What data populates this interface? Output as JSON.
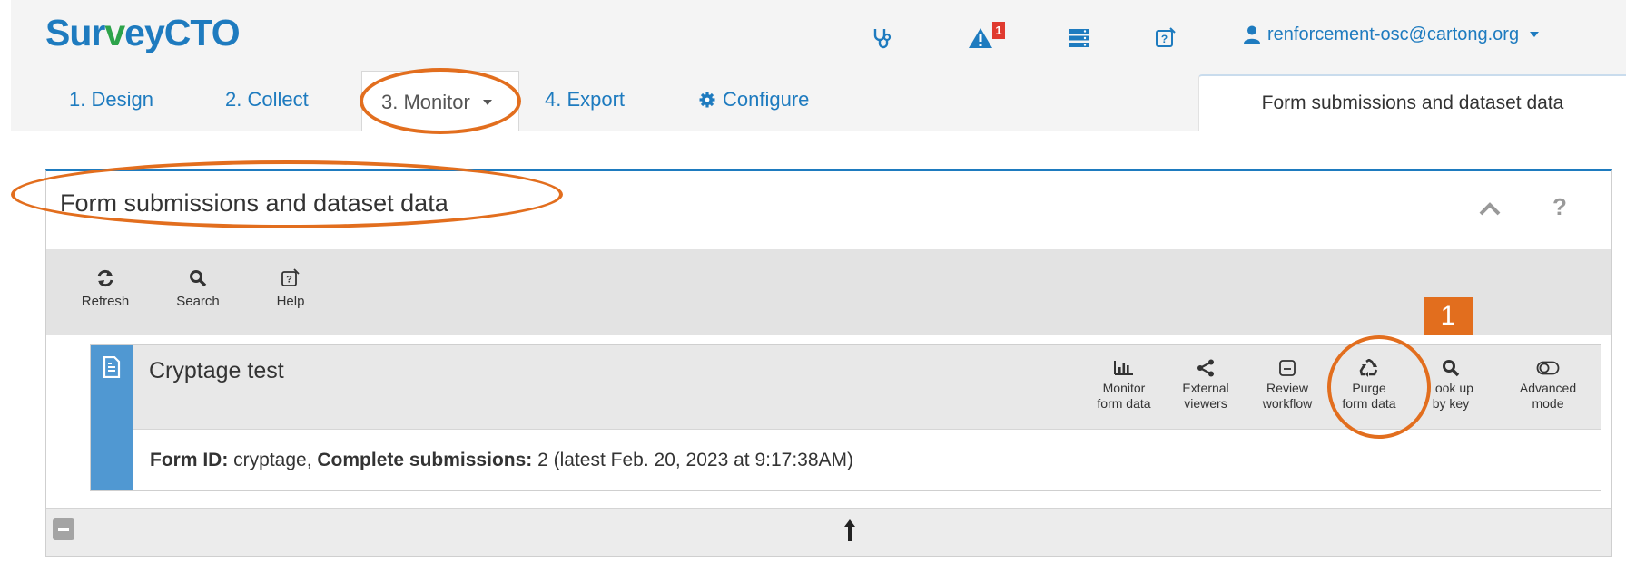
{
  "app": {
    "logo_part1": "Sur",
    "logo_part2": "v",
    "logo_part3": "eyCTO"
  },
  "header": {
    "alert_count": "1",
    "user_email": "renforcement-osc@cartong.org",
    "icons": [
      "stethoscope-icon",
      "warning-icon",
      "server-icon",
      "help-icon",
      "user-icon"
    ]
  },
  "nav": {
    "tabs": [
      {
        "label": "1. Design"
      },
      {
        "label": "2. Collect"
      },
      {
        "label": "3. Monitor"
      },
      {
        "label": "4. Export"
      },
      {
        "label": "Configure"
      }
    ],
    "right_tab_label": "Form submissions and dataset data"
  },
  "panel": {
    "title": "Form submissions and dataset data",
    "help_label": "?"
  },
  "toolbar": {
    "refresh_label": "Refresh",
    "search_label": "Search",
    "help_label": "Help"
  },
  "form": {
    "name": "Cryptage test",
    "actions": [
      {
        "label": "Monitor\nform data",
        "icon": "bar-chart-icon"
      },
      {
        "label": "External\nviewers",
        "icon": "share-icon"
      },
      {
        "label": "Review\nworkflow",
        "icon": "review-icon"
      },
      {
        "label": "Purge\nform data",
        "icon": "recycle-icon"
      },
      {
        "label": "Look up\nby key",
        "icon": "search-icon"
      },
      {
        "label": "Advanced\nmode",
        "icon": "toggle-icon"
      }
    ],
    "form_id_label": "Form ID:",
    "form_id_value": "cryptage",
    "complete_label": "Complete submissions:",
    "complete_value": "2 (latest Feb. 20, 2023 at 9:17:38AM)"
  },
  "annotations": {
    "step_number": "1"
  },
  "colors": {
    "brand_blue": "#1e7bbf",
    "brand_green": "#2da34a",
    "annotation_orange": "#e26e1e",
    "card_strip_blue": "#5098d2",
    "alert_red": "#e03a2f"
  }
}
